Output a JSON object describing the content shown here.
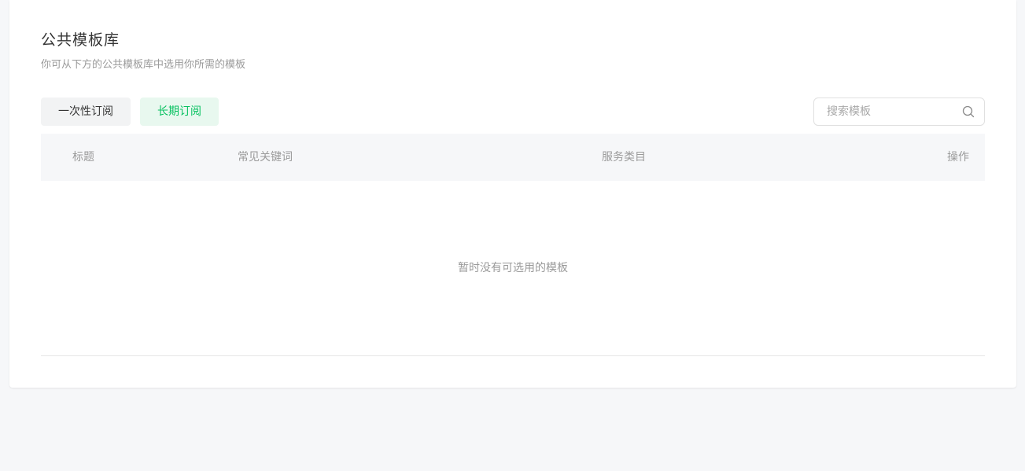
{
  "header": {
    "title": "公共模板库",
    "subtitle": "你可从下方的公共模板库中选用你所需的模板"
  },
  "tabs": [
    {
      "label": "一次性订阅",
      "active": false
    },
    {
      "label": "长期订阅",
      "active": true
    }
  ],
  "search": {
    "placeholder": "搜索模板",
    "value": "",
    "icon": "search-icon"
  },
  "table": {
    "columns": [
      "标题",
      "常见关键词",
      "服务类目",
      "操作"
    ],
    "rows": [],
    "empty_text": "暂时没有可选用的模板"
  },
  "colors": {
    "accent": "#07c160",
    "accent_bg": "#e8f8ef",
    "text_primary": "#353535",
    "text_secondary": "#9a9a9a",
    "page_bg": "#f6f7f9"
  }
}
